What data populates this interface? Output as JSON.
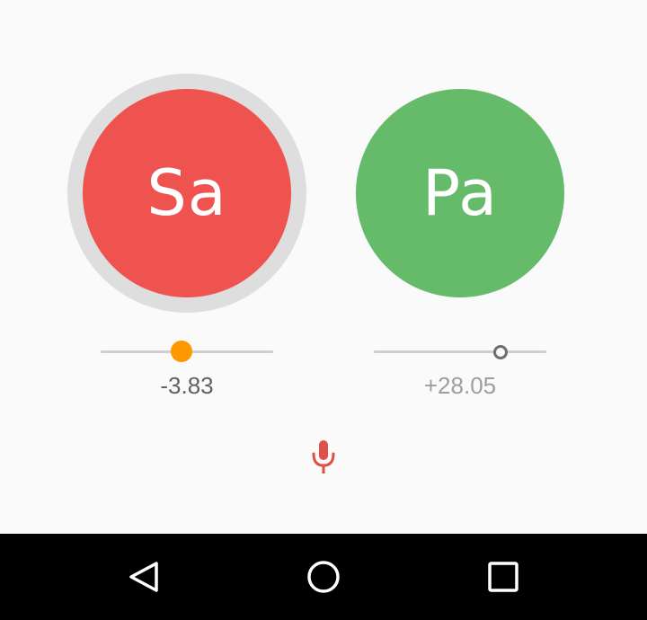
{
  "notes": {
    "sa": {
      "label": "Sa",
      "color": "#ef5350",
      "ring_color": "#dedede",
      "active": true
    },
    "pa": {
      "label": "Pa",
      "color": "#66bb6a",
      "active": false
    }
  },
  "tuning": {
    "sa": {
      "cents_text": "-3.83",
      "slider_fraction": 0.47,
      "thumb_color": "#ff9800",
      "thumb_style": "filled"
    },
    "pa": {
      "cents_text": "+28.05",
      "slider_fraction": 0.735,
      "thumb_color": "#6e6e6e",
      "thumb_style": "hollow"
    }
  },
  "mic": {
    "icon": "microphone-icon",
    "color": "#e0504a"
  },
  "navigation_bar": {
    "background": "#000000",
    "buttons": [
      {
        "name": "back",
        "icon": "back-triangle-icon"
      },
      {
        "name": "home",
        "icon": "home-circle-icon"
      },
      {
        "name": "recents",
        "icon": "recents-square-icon"
      }
    ]
  }
}
